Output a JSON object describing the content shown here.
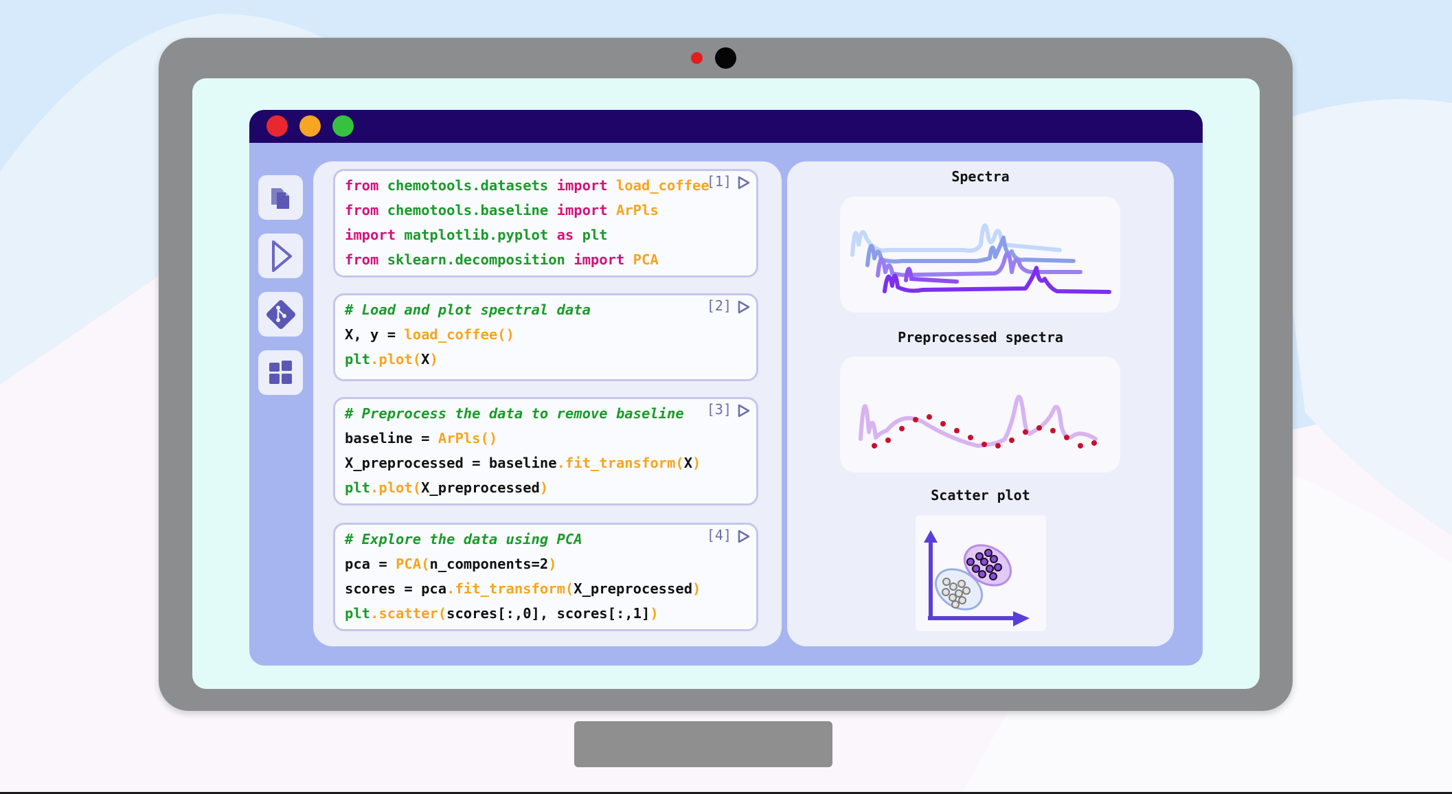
{
  "colors": {
    "keyword": "#d4137a",
    "module": "#1b9a2b",
    "function": "#f7a51e",
    "comment": "#1b9a2b",
    "titlebar": "#1e0567",
    "window_bg": "#a6b5f0"
  },
  "window": {
    "traffic_lights": [
      "close",
      "minimize",
      "maximize"
    ]
  },
  "sidebar": {
    "items": [
      {
        "icon": "files-icon"
      },
      {
        "icon": "run-icon"
      },
      {
        "icon": "git-icon"
      },
      {
        "icon": "extensions-icon"
      }
    ]
  },
  "cells": [
    {
      "number": "[1]",
      "lines": [
        [
          {
            "t": "from",
            "c": "kw"
          },
          {
            "t": " ",
            "c": "tx"
          },
          {
            "t": "chemotools.datasets",
            "c": "mod"
          },
          {
            "t": " ",
            "c": "tx"
          },
          {
            "t": "import",
            "c": "kw"
          },
          {
            "t": " ",
            "c": "tx"
          },
          {
            "t": "load_coffee",
            "c": "fn"
          }
        ],
        [
          {
            "t": "from",
            "c": "kw"
          },
          {
            "t": " ",
            "c": "tx"
          },
          {
            "t": "chemotools.baseline",
            "c": "mod"
          },
          {
            "t": " ",
            "c": "tx"
          },
          {
            "t": "import",
            "c": "kw"
          },
          {
            "t": " ",
            "c": "tx"
          },
          {
            "t": "ArPls",
            "c": "fn"
          }
        ],
        [
          {
            "t": "import",
            "c": "kw"
          },
          {
            "t": " ",
            "c": "tx"
          },
          {
            "t": "matplotlib.pyplot",
            "c": "mod"
          },
          {
            "t": " ",
            "c": "tx"
          },
          {
            "t": "as",
            "c": "kw"
          },
          {
            "t": " ",
            "c": "tx"
          },
          {
            "t": "plt",
            "c": "mod"
          }
        ],
        [
          {
            "t": "from",
            "c": "kw"
          },
          {
            "t": " ",
            "c": "tx"
          },
          {
            "t": "sklearn.decomposition",
            "c": "mod"
          },
          {
            "t": " ",
            "c": "tx"
          },
          {
            "t": "import",
            "c": "kw"
          },
          {
            "t": " ",
            "c": "tx"
          },
          {
            "t": "PCA",
            "c": "fn"
          }
        ]
      ]
    },
    {
      "number": "[2]",
      "lines": [
        [
          {
            "t": "# Load and plot spectral data",
            "c": "cm"
          }
        ],
        [
          {
            "t": "X, y = ",
            "c": "tx"
          },
          {
            "t": "load_coffee()",
            "c": "fn"
          }
        ],
        [
          {
            "t": "plt",
            "c": "mod"
          },
          {
            "t": ".plot(",
            "c": "fn"
          },
          {
            "t": "X",
            "c": "tx"
          },
          {
            "t": ")",
            "c": "fn"
          }
        ]
      ]
    },
    {
      "number": "[3]",
      "lines": [
        [
          {
            "t": "# Preprocess the data to remove baseline",
            "c": "cm"
          }
        ],
        [
          {
            "t": "baseline = ",
            "c": "tx"
          },
          {
            "t": "ArPls()",
            "c": "fn"
          }
        ],
        [
          {
            "t": "X_preprocessed = baseline",
            "c": "tx"
          },
          {
            "t": ".fit_transform(",
            "c": "fn"
          },
          {
            "t": "X",
            "c": "tx"
          },
          {
            "t": ")",
            "c": "fn"
          }
        ],
        [
          {
            "t": "plt",
            "c": "mod"
          },
          {
            "t": ".plot(",
            "c": "fn"
          },
          {
            "t": "X_preprocessed",
            "c": "tx"
          },
          {
            "t": ")",
            "c": "fn"
          }
        ]
      ]
    },
    {
      "number": "[4]",
      "lines": [
        [
          {
            "t": "# Explore the data using PCA",
            "c": "cm"
          }
        ],
        [
          {
            "t": "pca = ",
            "c": "tx"
          },
          {
            "t": "PCA(",
            "c": "fn"
          },
          {
            "t": "n_components=2",
            "c": "tx"
          },
          {
            "t": ")",
            "c": "fn"
          }
        ],
        [
          {
            "t": "scores = pca",
            "c": "tx"
          },
          {
            "t": ".fit_transform(",
            "c": "fn"
          },
          {
            "t": "X_preprocessed",
            "c": "tx"
          },
          {
            "t": ")",
            "c": "fn"
          }
        ],
        [
          {
            "t": "plt",
            "c": "mod"
          },
          {
            "t": ".scatter(",
            "c": "fn"
          },
          {
            "t": "scores[:,0], scores[:,1]",
            "c": "tx"
          },
          {
            "t": ")",
            "c": "fn"
          }
        ]
      ]
    }
  ],
  "plots": {
    "spectra": {
      "title": "Spectra"
    },
    "preprocessed": {
      "title": "Preprocessed spectra"
    },
    "scatter": {
      "title": "Scatter plot"
    }
  }
}
